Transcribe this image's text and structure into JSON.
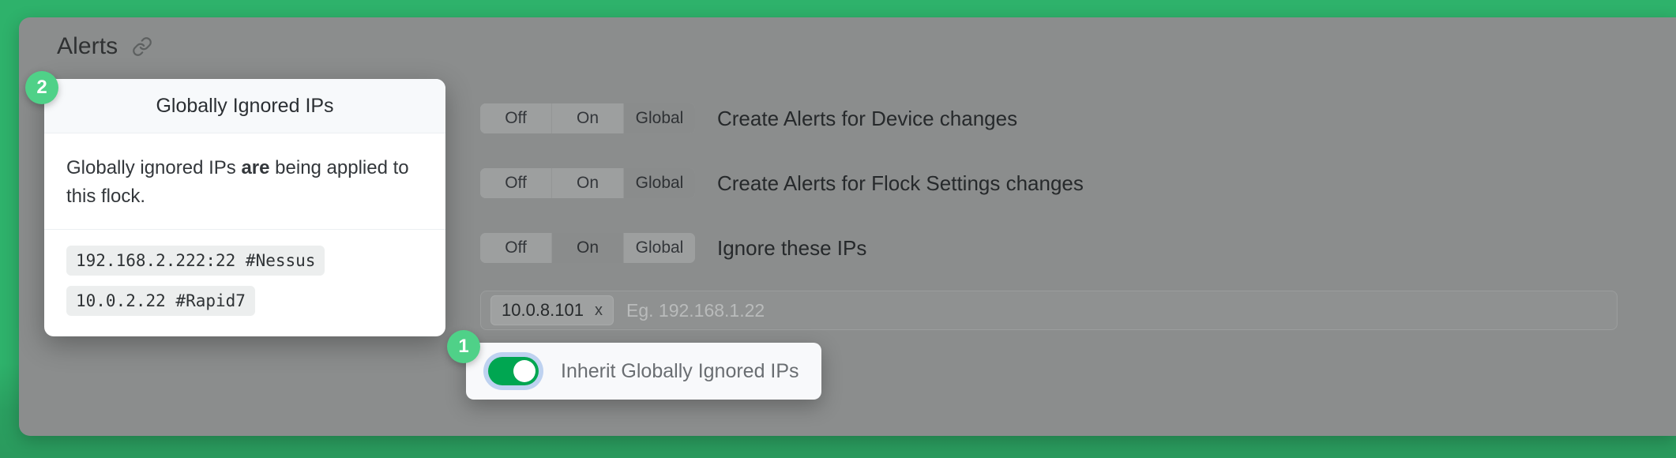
{
  "panel": {
    "title": "Alerts",
    "link_icon": "link-icon"
  },
  "settings": {
    "segmented_options": [
      "Off",
      "On",
      "Global"
    ],
    "rows": [
      {
        "label": "Create Alerts for Device changes",
        "selected": "Global"
      },
      {
        "label": "Create Alerts for Flock Settings changes",
        "selected": "Global"
      },
      {
        "label": "Ignore these IPs",
        "selected": "On"
      }
    ]
  },
  "ip_input": {
    "tags": [
      {
        "value": "10.0.8.101",
        "remove_label": "x"
      }
    ],
    "placeholder": "Eg. 192.168.1.22"
  },
  "popover": {
    "title": "Globally Ignored IPs",
    "message_prefix": "Globally ignored IPs ",
    "message_bold": "are",
    "message_suffix": " being applied to this flock.",
    "ips": [
      "192.168.2.222:22 #Nessus",
      "10.0.2.22 #Rapid7"
    ]
  },
  "toggle_card": {
    "label": "Inherit Globally Ignored IPs",
    "state": "on"
  },
  "step_badges": {
    "one": "1",
    "two": "2"
  },
  "colors": {
    "background_green": "#2eb26b",
    "panel_grey": "#8b8d8d",
    "badge_green": "#4fd188",
    "switch_on_green": "#00a651",
    "focus_ring_blue": "#bed2f0"
  }
}
